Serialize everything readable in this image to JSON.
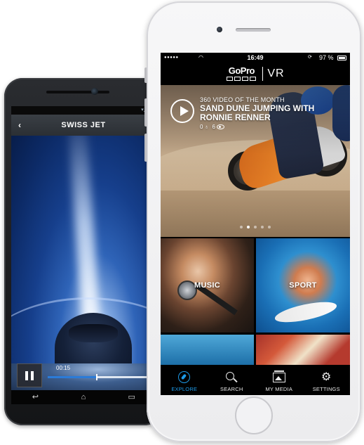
{
  "android": {
    "app_title": "SWISS JET",
    "video_time": "00:15",
    "progress_fraction": 0.45
  },
  "iphone": {
    "status": {
      "time": "16:49",
      "battery": "97 %"
    },
    "header": {
      "logo_text": "GoPro",
      "logo_suffix": "VR"
    },
    "hero": {
      "kicker": "360 VIDEO OF THE MONTH",
      "title": "SAND DUNE JUMPING WITH RONNIE RENNER",
      "likes": "0",
      "views": "6",
      "page_count": 5,
      "active_page": 1
    },
    "categories": [
      {
        "label": "MUSIC"
      },
      {
        "label": "SPORT"
      }
    ],
    "tabs": [
      {
        "label": "EXPLORE",
        "icon": "compass-icon",
        "active": true
      },
      {
        "label": "SEARCH",
        "icon": "search-icon",
        "active": false
      },
      {
        "label": "MY MEDIA",
        "icon": "media-icon",
        "active": false
      },
      {
        "label": "SETTINGS",
        "icon": "gear-icon",
        "active": false
      }
    ]
  },
  "colors": {
    "accent": "#1d9ae8",
    "android_progress": "#2b7bd8"
  }
}
